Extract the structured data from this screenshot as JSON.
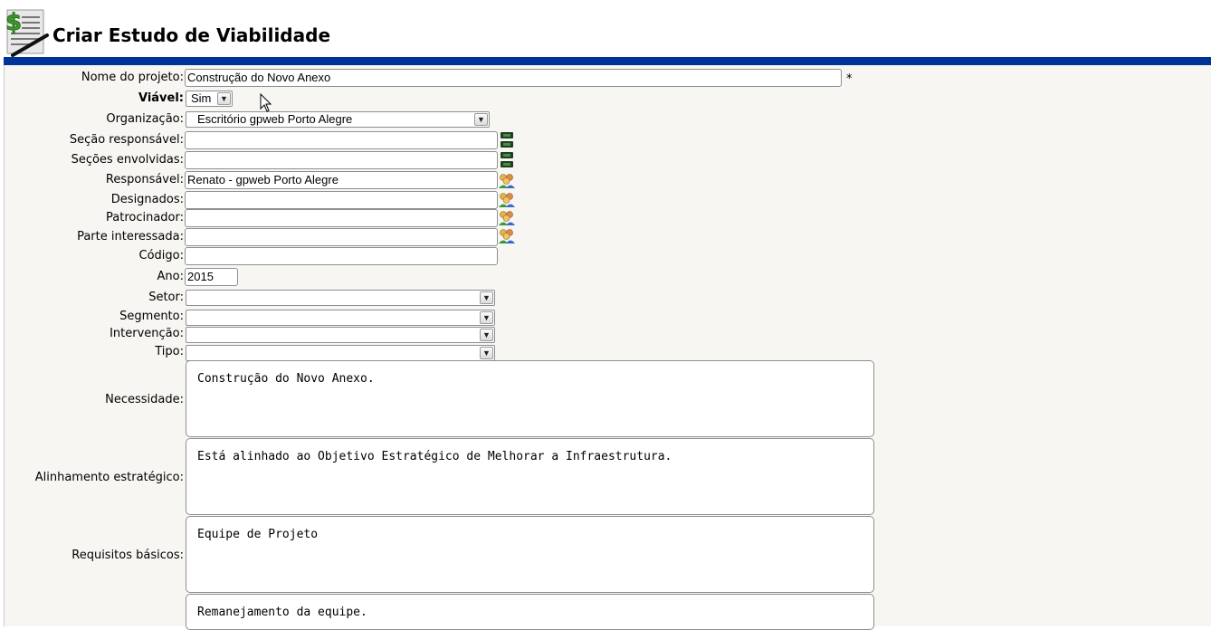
{
  "header": {
    "title": "Criar Estudo de Viabilidade",
    "icon": "dollar-document-icon"
  },
  "form": {
    "nome_projeto": {
      "label": "Nome do projeto:",
      "value": "Construção do Novo Anexo",
      "required_mark": "*"
    },
    "viavel": {
      "label": "Viável:",
      "value": "Sim"
    },
    "organizacao": {
      "label": "Organização:",
      "value": "Escritório gpweb Porto Alegre"
    },
    "secao_responsavel": {
      "label": "Seção responsável:",
      "value": ""
    },
    "secoes_envolvidas": {
      "label": "Seções envolvidas:",
      "value": ""
    },
    "responsavel": {
      "label": "Responsável:",
      "value": "Renato - gpweb Porto Alegre"
    },
    "designados": {
      "label": "Designados:",
      "value": ""
    },
    "patrocinador": {
      "label": "Patrocinador:",
      "value": ""
    },
    "parte_interessada": {
      "label": "Parte interessada:",
      "value": ""
    },
    "codigo": {
      "label": "Código:",
      "value": ""
    },
    "ano": {
      "label": "Ano:",
      "value": "2015"
    },
    "setor": {
      "label": "Setor:",
      "value": ""
    },
    "segmento": {
      "label": "Segmento:",
      "value": ""
    },
    "intervencao": {
      "label": "Intervenção:",
      "value": ""
    },
    "tipo": {
      "label": "Tipo:",
      "value": ""
    },
    "necessidade": {
      "label": "Necessidade:",
      "value": "Construção do Novo Anexo."
    },
    "alinhamento": {
      "label": "Alinhamento estratégico:",
      "value": "Está alinhado ao Objetivo Estratégico de Melhorar a Infraestrutura."
    },
    "requisitos": {
      "label": "Requisitos básicos:",
      "value": "Equipe de Projeto"
    },
    "extra": {
      "value": "Remanejamento da equipe."
    }
  },
  "colors": {
    "header_bar": "#003399",
    "form_background": "#f7f6f2"
  }
}
